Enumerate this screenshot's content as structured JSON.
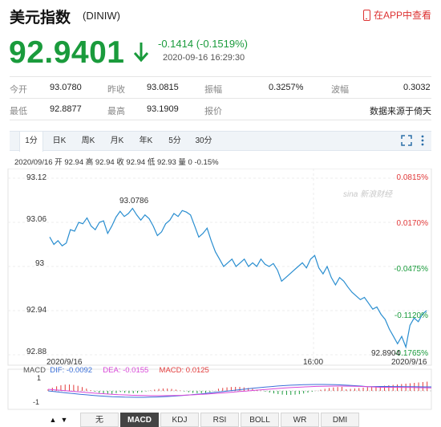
{
  "header": {
    "title": "美元指数",
    "code": "(DINIW)",
    "app_link": "在APP中查看"
  },
  "quote": {
    "price": "92.9401",
    "change": "-0.1414 (-0.1519%)",
    "time": "2020-09-16 16:29:30"
  },
  "stats": {
    "open_label": "今开",
    "open_value": "93.0780",
    "prev_close_label": "昨收",
    "prev_close_value": "93.0815",
    "amplitude_label": "振幅",
    "amplitude_value": "0.3257%",
    "wave_label": "波幅",
    "wave_value": "0.3032",
    "low_label": "最低",
    "low_value": "92.8877",
    "high_label": "最高",
    "high_value": "93.1909",
    "quote_label": "报价",
    "source_value": "数据来源于倚天"
  },
  "tabs": [
    {
      "label": "1分",
      "active": true
    },
    {
      "label": "日K"
    },
    {
      "label": "周K"
    },
    {
      "label": "月K"
    },
    {
      "label": "年K"
    },
    {
      "label": "5分"
    },
    {
      "label": "30分"
    }
  ],
  "info_line": "2020/09/16 开 92.94 高 92.94 收 92.94 低 92.93 量 0 -0.15%",
  "colors": {
    "up": "#e23b3b",
    "down": "#1a9b3c",
    "line": "#2a8ed0",
    "macd_dif": "#3a6fd8",
    "macd_dea": "#d848d8"
  },
  "chart_data": {
    "type": "line",
    "y_ticks": [
      "93.12",
      "93.06",
      "93",
      "92.94",
      "92.88"
    ],
    "pct_ticks": [
      {
        "label": "0.0815%",
        "dir": "up"
      },
      {
        "label": "0.0170%",
        "dir": "up"
      },
      {
        "label": "-0.0475%",
        "dir": "down"
      },
      {
        "label": "-0.1120%",
        "dir": "down"
      },
      {
        "label": "-0.1765%",
        "dir": "down"
      }
    ],
    "ylim": [
      92.88,
      93.12
    ],
    "x_labels": [
      "2020/9/16",
      "16:00",
      "2020/9/16"
    ],
    "watermark": "sina 新浪财经",
    "max_label": "93.0786",
    "min_label": "92.8904",
    "values": [
      93.04,
      93.03,
      93.035,
      93.028,
      93.032,
      93.05,
      93.048,
      93.06,
      93.058,
      93.066,
      93.055,
      93.05,
      93.06,
      93.062,
      93.045,
      93.055,
      93.067,
      93.075,
      93.068,
      93.072,
      93.079,
      93.07,
      93.063,
      93.07,
      93.065,
      93.055,
      93.042,
      93.047,
      93.058,
      93.063,
      93.072,
      93.068,
      93.076,
      93.074,
      93.07,
      93.055,
      93.04,
      93.045,
      93.052,
      93.035,
      93.02,
      93.01,
      93.0,
      93.005,
      93.01,
      93.0,
      93.005,
      93.01,
      93.0,
      93.005,
      93.0,
      93.01,
      93.003,
      93.0,
      93.004,
      92.995,
      92.98,
      92.985,
      92.99,
      92.995,
      93.0,
      93.005,
      92.998,
      93.01,
      93.015,
      92.998,
      92.99,
      93.0,
      92.985,
      92.975,
      92.985,
      92.98,
      92.972,
      92.965,
      92.96,
      92.955,
      92.958,
      92.95,
      92.942,
      92.945,
      92.935,
      92.928,
      92.915,
      92.905,
      92.895,
      92.905,
      92.8904,
      92.92,
      92.93,
      92.925,
      92.935,
      92.94
    ]
  },
  "macd": {
    "label": "MACD",
    "dif": "DIF: -0.0092",
    "dea": "DEA: -0.0155",
    "macd": "MACD: 0.0125",
    "ticks": [
      "1",
      "-1"
    ]
  },
  "bottom_tabs": [
    "无",
    "MACD",
    "KDJ",
    "RSI",
    "BOLL",
    "WR",
    "DMI"
  ],
  "bottom_active": "MACD",
  "scroll": {
    "up": "▲",
    "down": "▼"
  }
}
